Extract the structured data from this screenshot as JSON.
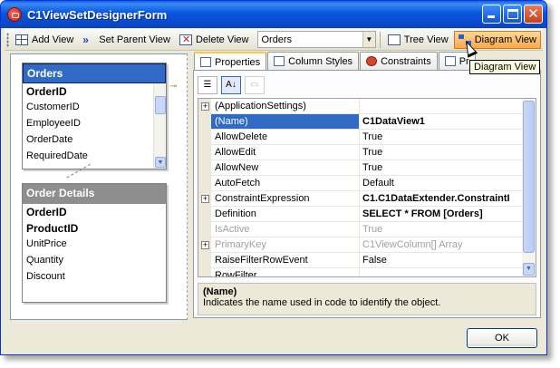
{
  "window": {
    "title": "C1ViewSetDesignerForm"
  },
  "toolbar": {
    "add_view": "Add View",
    "set_parent_view": "Set Parent View",
    "delete_view": "Delete View",
    "view_selector_value": "Orders",
    "tree_view": "Tree View",
    "diagram_view": "Diagram View"
  },
  "tooltip": "Diagram View",
  "diagram": {
    "tables": [
      {
        "name": "Orders",
        "fields": [
          {
            "name": "OrderID",
            "pk": true
          },
          {
            "name": "CustomerID"
          },
          {
            "name": "EmployeeID"
          },
          {
            "name": "OrderDate"
          },
          {
            "name": "RequiredDate"
          }
        ]
      },
      {
        "name": "Order Details",
        "fields": [
          {
            "name": "OrderID",
            "pk": true
          },
          {
            "name": "ProductID",
            "pk": true
          },
          {
            "name": "UnitPrice"
          },
          {
            "name": "Quantity"
          },
          {
            "name": "Discount"
          }
        ]
      }
    ]
  },
  "tabs": [
    "Properties",
    "Column Styles",
    "Constraints",
    "Pr"
  ],
  "properties": [
    {
      "name": "(ApplicationSettings)",
      "value": "",
      "expand": true
    },
    {
      "name": "(Name)",
      "value": "C1DataView1",
      "bold": true,
      "selected": true
    },
    {
      "name": "AllowDelete",
      "value": "True"
    },
    {
      "name": "AllowEdit",
      "value": "True"
    },
    {
      "name": "AllowNew",
      "value": "True"
    },
    {
      "name": "AutoFetch",
      "value": "Default"
    },
    {
      "name": "ConstraintExpression",
      "value": "C1.C1DataExtender.ConstraintI",
      "bold": true,
      "expand": true
    },
    {
      "name": "Definition",
      "value": "SELECT * FROM [Orders]",
      "bold": true
    },
    {
      "name": "IsActive",
      "value": "True",
      "dim": true
    },
    {
      "name": "PrimaryKey",
      "value": "C1ViewColumn[] Array",
      "dim": true,
      "expand": true
    },
    {
      "name": "RaiseFilterRowEvent",
      "value": "False"
    },
    {
      "name": "RowFilter",
      "value": ""
    }
  ],
  "description": {
    "title": "(Name)",
    "text": "Indicates the name used in code to identify the object."
  },
  "ok_button": "OK"
}
